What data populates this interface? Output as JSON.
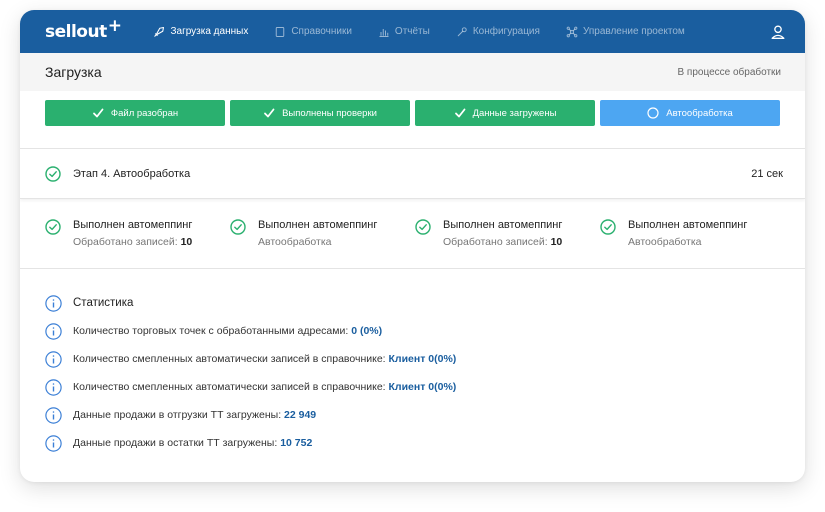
{
  "brand": {
    "logo": "sellout",
    "logo_plus": "+"
  },
  "nav": {
    "items": [
      {
        "label": "Загрузка данных",
        "icon": "rocket-icon",
        "active": true
      },
      {
        "label": "Справочники",
        "icon": "book-icon",
        "active": false
      },
      {
        "label": "Отчёты",
        "icon": "bar-chart-icon",
        "active": false
      },
      {
        "label": "Конфигурация",
        "icon": "wrench-icon",
        "active": false
      },
      {
        "label": "Управление проектом",
        "icon": "network-icon",
        "active": false
      }
    ]
  },
  "header": {
    "title": "Загрузка",
    "status": "В процессе обработки"
  },
  "steps": [
    {
      "label": "Файл разобран",
      "state": "done"
    },
    {
      "label": "Выполнены проверки",
      "state": "done"
    },
    {
      "label": "Данные загружены",
      "state": "done"
    },
    {
      "label": "Автообработка",
      "state": "current"
    }
  ],
  "stage": {
    "label": "Этап 4. Автообработка",
    "time": "21 сек"
  },
  "automapping": [
    {
      "title": "Выполнен автомеппинг",
      "sub": "Обработано записей:",
      "value": "10"
    },
    {
      "title": "Выполнен автомеппинг",
      "sub": "Автообработка",
      "value": ""
    },
    {
      "title": "Выполнен автомеппинг",
      "sub": "Обработано записей:",
      "value": "10"
    },
    {
      "title": "Выполнен автомеппинг",
      "sub": "Автообработка",
      "value": ""
    }
  ],
  "stats": {
    "title": "Статистика",
    "rows": [
      {
        "text": "Количество торговых точек с обработанными адресами:",
        "value": "0 (0%)"
      },
      {
        "text": "Количество смепленных автоматически записей в справочнике:",
        "value": "Клиент 0(0%)"
      },
      {
        "text": "Количество смепленных автоматически записей в справочнике:",
        "value": "Клиент 0(0%)"
      },
      {
        "text": "Данные продажи в отгрузки ТТ загружены:",
        "value": "22 949"
      },
      {
        "text": "Данные продажи в остатки ТТ загружены:",
        "value": "10 752"
      }
    ]
  },
  "colors": {
    "topbar": "#1a5e9f",
    "header_bg": "#f5f5f5",
    "step_done": "#2ab06f",
    "step_current": "#4da6f2",
    "check": "#2ab06f",
    "info": "#3b7fd6",
    "value": "#1a5e9f"
  }
}
